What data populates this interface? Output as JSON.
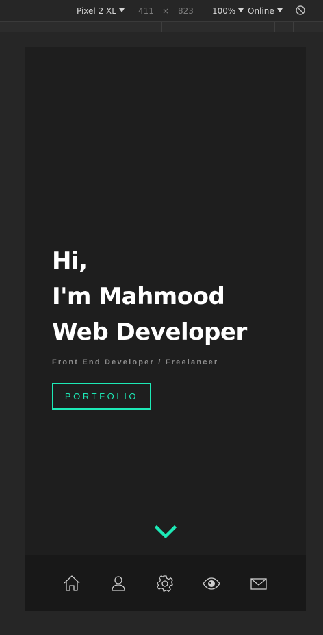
{
  "devtools": {
    "device": "Pixel 2 XL",
    "width": "411",
    "times": "×",
    "height": "823",
    "zoom": "100%",
    "network": "Online"
  },
  "hero": {
    "line1": "Hi,",
    "line2": "I'm Mahmood",
    "line3": "Web Developer",
    "subtitle": "Front End Developer / Freelancer",
    "button": "PORTFOLIO"
  },
  "colors": {
    "accent": "#1de9b6",
    "background": "#1e1e1e",
    "nav_background": "#181818",
    "icon": "#cfcfcf"
  },
  "nav": {
    "items": [
      {
        "icon": "home-icon"
      },
      {
        "icon": "user-icon"
      },
      {
        "icon": "gear-icon"
      },
      {
        "icon": "eye-icon"
      },
      {
        "icon": "mail-icon"
      }
    ]
  }
}
